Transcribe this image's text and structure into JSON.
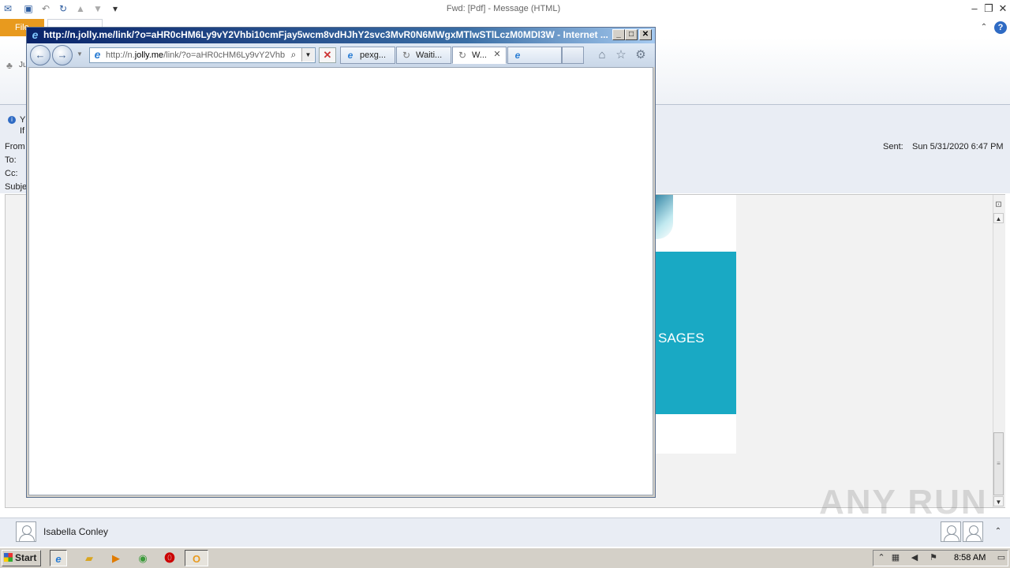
{
  "outlook": {
    "title": "Fwd: [Pdf]    -  Message (HTML)",
    "file_tab": "File",
    "header": {
      "from_label": "From",
      "to_label": "To:",
      "cc_label": "Cc:",
      "subject_label": "Subje",
      "sent_label": "Sent:",
      "sent_value": "Sun 5/31/2020 6:47 PM",
      "info_line1": "Y",
      "info_line2": "If",
      "ribbon_frag": "Ju"
    },
    "email_banner_text": "SAGES",
    "contact_name": "Isabella Conley",
    "watermark": "ANY RUN"
  },
  "ie": {
    "title": "http://n.jolly.me/link/?o=aHR0cHM6Ly9vY2Vhbi10cmFjay5wcm8vdHJhY2svc3MvR0N6MWgxMTlwSTlLczM0MDI3W - Internet ...",
    "address_prefix": "http://n.",
    "address_host": "jolly.me",
    "address_rest": "/link/?o=aHR0cHM6Ly9vY2Vhb",
    "tabs": [
      {
        "label": "pexg...",
        "icon": "ie-icon"
      },
      {
        "label": "Waiti...",
        "icon": "loading-icon"
      },
      {
        "label": "W...",
        "icon": "loading-icon"
      },
      {
        "label": "",
        "icon": "ie-icon"
      }
    ]
  },
  "taskbar": {
    "start_label": "Start",
    "clock": "8:58 AM"
  },
  "colors": {
    "teal": "#19a9c4",
    "file_tab": "#e89a1e",
    "ie_title": "#0a246a"
  }
}
